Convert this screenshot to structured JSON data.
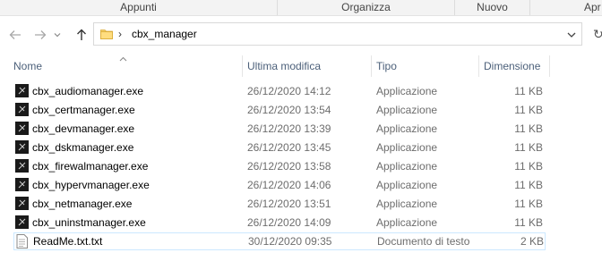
{
  "ribbon": {
    "groups": [
      {
        "label": "Appunti"
      },
      {
        "label": "Organizza"
      },
      {
        "label": "Nuovo"
      },
      {
        "label": "Apr"
      }
    ]
  },
  "address": {
    "separator": "›",
    "path": "cbx_manager"
  },
  "columns": {
    "name": "Nome",
    "modified": "Ultima modifica",
    "type": "Tipo",
    "size": "Dimensione"
  },
  "files": [
    {
      "name": "cbx_audiomanager.exe",
      "modified": "26/12/2020 14:12",
      "type": "Applicazione",
      "size": "11 KB",
      "icon": "exe-icon"
    },
    {
      "name": "cbx_certmanager.exe",
      "modified": "26/12/2020 13:54",
      "type": "Applicazione",
      "size": "11 KB",
      "icon": "exe-icon"
    },
    {
      "name": "cbx_devmanager.exe",
      "modified": "26/12/2020 13:39",
      "type": "Applicazione",
      "size": "11 KB",
      "icon": "exe-icon"
    },
    {
      "name": "cbx_dskmanager.exe",
      "modified": "26/12/2020 13:45",
      "type": "Applicazione",
      "size": "11 KB",
      "icon": "exe-icon"
    },
    {
      "name": "cbx_firewalmanager.exe",
      "modified": "26/12/2020 13:58",
      "type": "Applicazione",
      "size": "11 KB",
      "icon": "exe-icon"
    },
    {
      "name": "cbx_hypervmanager.exe",
      "modified": "26/12/2020 14:06",
      "type": "Applicazione",
      "size": "11 KB",
      "icon": "exe-icon"
    },
    {
      "name": "cbx_netmanager.exe",
      "modified": "26/12/2020 13:51",
      "type": "Applicazione",
      "size": "11 KB",
      "icon": "exe-icon"
    },
    {
      "name": "cbx_uninstmanager.exe",
      "modified": "26/12/2020 14:09",
      "type": "Applicazione",
      "size": "11 KB",
      "icon": "exe-icon"
    },
    {
      "name": "ReadMe.txt.txt",
      "modified": "30/12/2020 09:35",
      "type": "Documento di testo",
      "size": "2 KB",
      "icon": "text-document-icon"
    }
  ]
}
